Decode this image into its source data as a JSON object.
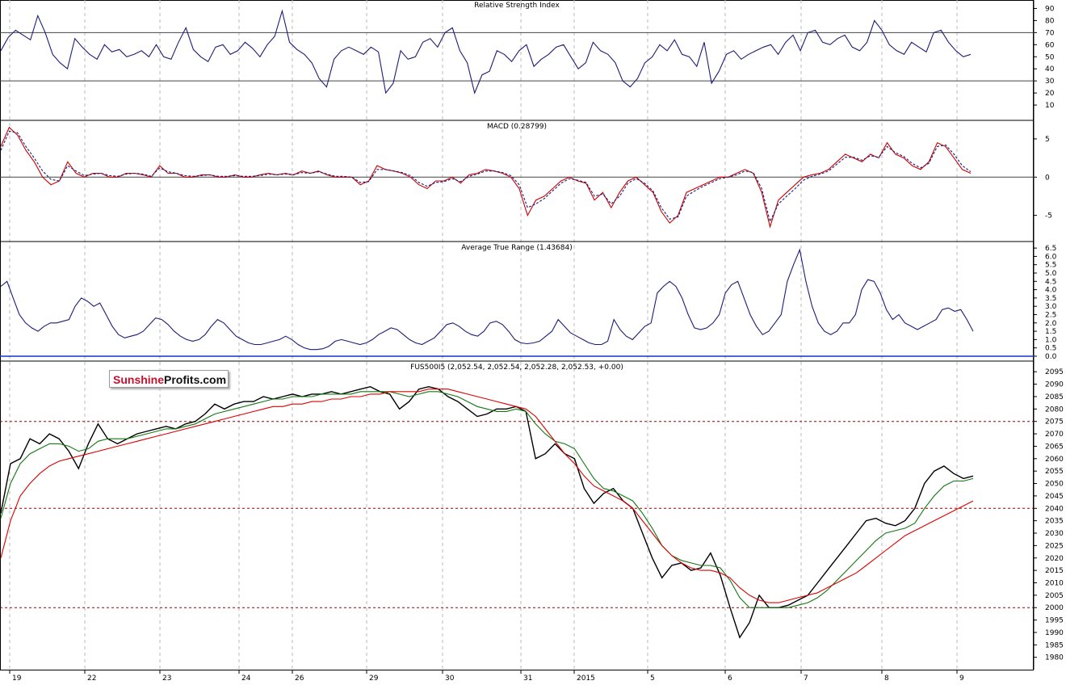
{
  "logo": {
    "part1": "Sunshine",
    "part2": "Profits.com"
  },
  "colors": {
    "rsi": "#1c1c7a",
    "macd": "#cc0000",
    "signal": "#1c1c7a",
    "atr": "#1c1c7a",
    "price": "#000000",
    "ma_fast": "#117711",
    "ma_slow": "#dd0000",
    "level": "#990000",
    "grid": "#b8b8b8"
  },
  "x_axis": {
    "labels": [
      "19",
      "22",
      "23",
      "24",
      "26",
      "29",
      "30",
      "31",
      "2015",
      "5",
      "6",
      "7",
      "8",
      "9"
    ]
  },
  "chart_data": [
    {
      "type": "line",
      "title": "Relative Strength Index",
      "ylim": [
        0,
        95
      ],
      "yticks": [
        10,
        20,
        30,
        40,
        50,
        60,
        70,
        80,
        90
      ],
      "levels": [
        30,
        70
      ],
      "series": [
        {
          "values": [
            55,
            66,
            72,
            68,
            64,
            84,
            70,
            52,
            45,
            40,
            65,
            58,
            52,
            48,
            60,
            54,
            56,
            50,
            52,
            55,
            50,
            60,
            50,
            48,
            62,
            74,
            56,
            50,
            46,
            58,
            60,
            52,
            55,
            62,
            57,
            50,
            60,
            67,
            88,
            62,
            56,
            52,
            45,
            32,
            25,
            48,
            55,
            58,
            55,
            52,
            58,
            54,
            20,
            28,
            55,
            48,
            50,
            62,
            65,
            58,
            70,
            74,
            55,
            45,
            20,
            35,
            38,
            55,
            52,
            46,
            55,
            60,
            42,
            48,
            52,
            58,
            60,
            50,
            40,
            45,
            62,
            55,
            52,
            45,
            30,
            25,
            32,
            45,
            50,
            60,
            55,
            64,
            52,
            50,
            42,
            62,
            28,
            38,
            52,
            55,
            48,
            52,
            55,
            58,
            60,
            52,
            62,
            68,
            55,
            70,
            72,
            62,
            60,
            65,
            68,
            58,
            55,
            62,
            80,
            72,
            60,
            55,
            52,
            62,
            58,
            54,
            70,
            72,
            62,
            55,
            50,
            52
          ]
        }
      ]
    },
    {
      "type": "line",
      "title": "MACD (0.28799)",
      "ylim": [
        -8,
        7
      ],
      "yticks": [
        -5,
        0,
        5
      ],
      "levels": [
        0
      ],
      "series": [
        {
          "values": [
            4,
            6.5,
            5.5,
            3.5,
            2,
            0,
            -1,
            -0.5,
            2,
            0.5,
            0,
            0.5,
            0.5,
            0,
            0,
            0.5,
            0.5,
            0.3,
            0,
            1.5,
            0.5,
            0.5,
            0,
            0,
            0.3,
            0.3,
            0,
            0,
            0.3,
            0,
            0,
            0.3,
            0.5,
            0.3,
            0.5,
            0.3,
            0.8,
            0.5,
            0.8,
            0.3,
            0,
            0,
            0,
            -1,
            -0.5,
            1.5,
            1,
            0.8,
            0.5,
            0,
            -1,
            -1.5,
            -0.5,
            -0.5,
            0,
            -0.8,
            0.3,
            0.5,
            1,
            0.8,
            0.5,
            0,
            -1.5,
            -5,
            -3,
            -2.5,
            -1.5,
            -0.5,
            0,
            -0.5,
            -0.8,
            -3,
            -2,
            -4,
            -2,
            -0.5,
            0,
            -1,
            -2,
            -4.5,
            -6,
            -5,
            -2,
            -1.5,
            -1,
            -0.5,
            0,
            0,
            0.5,
            1,
            0.5,
            -2,
            -6.5,
            -3,
            -2,
            -1,
            0,
            0.3,
            0.5,
            1,
            2,
            3,
            2.5,
            2,
            3,
            2.5,
            4.5,
            3,
            2.5,
            1.5,
            1,
            2,
            4.5,
            4,
            2.5,
            1,
            0.5
          ]
        },
        {
          "values": [
            3.5,
            6,
            5.8,
            4,
            2.5,
            0.8,
            -0.3,
            -0.5,
            1.5,
            0.8,
            0.2,
            0.4,
            0.5,
            0.2,
            0.1,
            0.4,
            0.5,
            0.4,
            0.1,
            1.2,
            0.7,
            0.5,
            0.2,
            0.1,
            0.2,
            0.3,
            0.1,
            0.1,
            0.2,
            0.1,
            0.1,
            0.2,
            0.4,
            0.3,
            0.4,
            0.3,
            0.6,
            0.5,
            0.7,
            0.4,
            0.1,
            0.1,
            0,
            -0.7,
            -0.6,
            1,
            1,
            0.8,
            0.6,
            0.2,
            -0.7,
            -1.2,
            -0.7,
            -0.6,
            -0.2,
            -0.6,
            0.1,
            0.4,
            0.8,
            0.8,
            0.6,
            0.2,
            -1,
            -4,
            -3.5,
            -2.8,
            -1.8,
            -0.8,
            -0.2,
            -0.4,
            -0.7,
            -2.5,
            -2.2,
            -3.5,
            -2.5,
            -0.8,
            -0.2,
            -0.8,
            -1.8,
            -4,
            -5.5,
            -5.2,
            -2.5,
            -1.8,
            -1.2,
            -0.7,
            -0.2,
            0,
            0.3,
            0.8,
            0.6,
            -1.5,
            -5.8,
            -3.5,
            -2.5,
            -1.5,
            -0.4,
            0.1,
            0.4,
            0.8,
            1.7,
            2.6,
            2.6,
            2.2,
            2.8,
            2.6,
            4,
            3.2,
            2.7,
            1.8,
            1.2,
            1.8,
            4,
            4.2,
            3,
            1.5,
            0.7
          ]
        }
      ]
    },
    {
      "type": "line",
      "title": "Average True Range (1.43684)",
      "ylim": [
        -0.1,
        6.7
      ],
      "yticks": [
        "0.0",
        "0.5",
        "1.0",
        "1.5",
        "2.0",
        "2.5",
        "3.0",
        "3.5",
        "4.0",
        "4.5",
        "5.0",
        "5.5",
        "6.0",
        "6.5"
      ],
      "series": [
        {
          "values": [
            4.2,
            4.5,
            3.5,
            2.5,
            2,
            1.7,
            1.5,
            1.8,
            2,
            2,
            2.1,
            2.2,
            3,
            3.5,
            3.3,
            3,
            3.2,
            2.5,
            1.8,
            1.3,
            1.1,
            1.2,
            1.3,
            1.5,
            1.9,
            2.3,
            2.2,
            1.9,
            1.5,
            1.2,
            1,
            0.9,
            1,
            1.3,
            1.8,
            2.2,
            2,
            1.6,
            1.2,
            1,
            0.8,
            0.7,
            0.7,
            0.8,
            0.9,
            1,
            1.2,
            1,
            0.7,
            0.5,
            0.4,
            0.4,
            0.45,
            0.6,
            0.9,
            1,
            0.9,
            0.8,
            0.7,
            0.8,
            1,
            1.3,
            1.5,
            1.7,
            1.6,
            1.3,
            1,
            0.8,
            0.7,
            0.9,
            1.1,
            1.5,
            1.9,
            2,
            1.8,
            1.5,
            1.3,
            1.2,
            1.5,
            2,
            2.1,
            1.9,
            1.5,
            1,
            0.8,
            0.75,
            0.8,
            0.9,
            1.2,
            1.5,
            2.2,
            1.8,
            1.4,
            1.2,
            1,
            0.8,
            0.7,
            0.7,
            0.9,
            2.2,
            1.6,
            1.2,
            1,
            1.4,
            1.8,
            2,
            3.8,
            4.2,
            4.5,
            4.2,
            3.5,
            2.5,
            1.7,
            1.6,
            1.7,
            2,
            2.5,
            3.8,
            4.3,
            4.5,
            3.5,
            2.5,
            1.8,
            1.3,
            1.5,
            2,
            2.5,
            4.5,
            5.5,
            6.4,
            4.5,
            3,
            2,
            1.5,
            1.3,
            1.5,
            2,
            2,
            2.5,
            4,
            4.6,
            4.5,
            3.8,
            2.8,
            2.2,
            2.5,
            2,
            1.8,
            1.6,
            1.8,
            2,
            2.2,
            2.8,
            2.9,
            2.7,
            2.8,
            2.2,
            1.5
          ]
        }
      ]
    },
    {
      "type": "line",
      "title": "FUS500I5 (2,052.54, 2,052.54, 2,052.28, 2,052.53, +0.00)",
      "ylim": [
        1976,
        2098
      ],
      "yticks": [
        1980,
        1985,
        1990,
        1995,
        2000,
        2005,
        2010,
        2015,
        2020,
        2025,
        2030,
        2035,
        2040,
        2045,
        2050,
        2055,
        2060,
        2065,
        2070,
        2075,
        2080,
        2085,
        2090,
        2095
      ],
      "levels": [
        2000,
        2040,
        2075
      ],
      "series": [
        {
          "values": [
            2038,
            2058,
            2060,
            2068,
            2066,
            2070,
            2068,
            2063,
            2056,
            2066,
            2074,
            2068,
            2066,
            2068,
            2070,
            2071,
            2072,
            2073,
            2072,
            2074,
            2075,
            2078,
            2082,
            2080,
            2082,
            2083,
            2083,
            2085,
            2084,
            2085,
            2086,
            2085,
            2086,
            2086,
            2087,
            2086,
            2087,
            2088,
            2089,
            2087,
            2086,
            2080,
            2083,
            2088,
            2089,
            2088,
            2085,
            2083,
            2080,
            2077,
            2078,
            2080,
            2080,
            2081,
            2079,
            2060,
            2062,
            2066,
            2062,
            2060,
            2048,
            2042,
            2046,
            2048,
            2043,
            2040,
            2030,
            2020,
            2012,
            2017,
            2018,
            2015,
            2016,
            2022,
            2013,
            2000,
            1988,
            1994,
            2005,
            2000,
            2000,
            2001,
            2003,
            2005,
            2010,
            2015,
            2020,
            2025,
            2030,
            2035,
            2036,
            2034,
            2033,
            2035,
            2040,
            2050,
            2055,
            2057,
            2054,
            2052,
            2053
          ]
        },
        {
          "values": [
            2036,
            2050,
            2058,
            2062,
            2064,
            2066,
            2066,
            2065,
            2063,
            2064,
            2067,
            2068,
            2068,
            2068,
            2069,
            2070,
            2071,
            2072,
            2072,
            2073,
            2074,
            2076,
            2078,
            2079,
            2080,
            2081,
            2082,
            2083,
            2084,
            2084,
            2085,
            2085,
            2085,
            2086,
            2086,
            2086,
            2086,
            2087,
            2087,
            2087,
            2087,
            2086,
            2085,
            2086,
            2087,
            2087,
            2086,
            2085,
            2083,
            2081,
            2080,
            2079,
            2079,
            2080,
            2079,
            2074,
            2070,
            2067,
            2066,
            2064,
            2058,
            2052,
            2048,
            2047,
            2045,
            2043,
            2038,
            2032,
            2025,
            2021,
            2019,
            2018,
            2017,
            2017,
            2016,
            2011,
            2004,
            2000,
            2000,
            2000,
            2000,
            2000,
            2001,
            2002,
            2004,
            2007,
            2011,
            2015,
            2019,
            2023,
            2027,
            2030,
            2031,
            2032,
            2034,
            2040,
            2045,
            2049,
            2051,
            2051,
            2052
          ]
        },
        {
          "values": [
            2020,
            2035,
            2045,
            2050,
            2054,
            2057,
            2059,
            2060,
            2061,
            2062,
            2063,
            2064,
            2065,
            2066,
            2067,
            2068,
            2069,
            2070,
            2071,
            2072,
            2073,
            2074,
            2075,
            2076,
            2077,
            2078,
            2079,
            2080,
            2081,
            2081,
            2082,
            2082,
            2083,
            2083,
            2084,
            2084,
            2085,
            2085,
            2086,
            2086,
            2087,
            2087,
            2087,
            2087,
            2088,
            2088,
            2088,
            2087,
            2086,
            2085,
            2084,
            2083,
            2082,
            2081,
            2080,
            2077,
            2072,
            2067,
            2062,
            2058,
            2053,
            2049,
            2047,
            2045,
            2043,
            2040,
            2035,
            2030,
            2025,
            2021,
            2018,
            2016,
            2015,
            2015,
            2014,
            2012,
            2008,
            2005,
            2003,
            2002,
            2002,
            2003,
            2004,
            2005,
            2006,
            2008,
            2010,
            2012,
            2014,
            2017,
            2020,
            2023,
            2026,
            2029,
            2031,
            2033,
            2035,
            2037,
            2039,
            2041,
            2043
          ]
        }
      ]
    }
  ]
}
